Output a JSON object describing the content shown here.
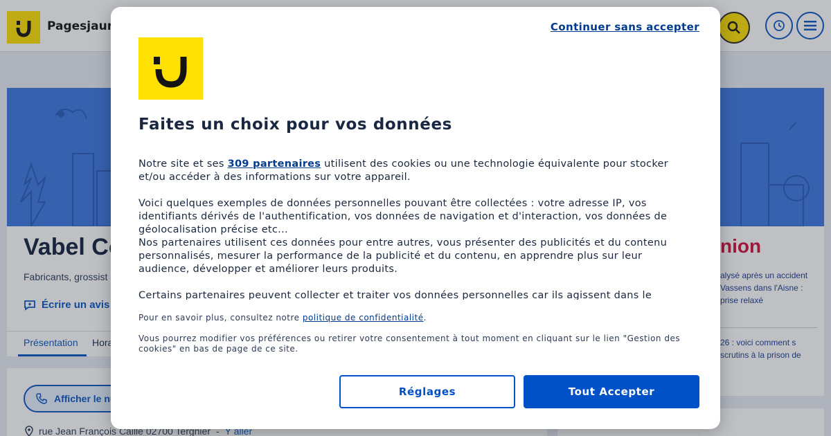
{
  "background": {
    "brand": "Pagesjaune",
    "business_name": "Vabel Co",
    "business_category": "Fabricants, grossist",
    "write_review": "Écrire un avis",
    "tabs": [
      {
        "label": "Présentation"
      },
      {
        "label": "Hora"
      }
    ],
    "phone_button": "Afficher le nu",
    "address": "rue Jean François Caille 02700 Tergnier",
    "address_sep": "-",
    "go_link": "Y aller",
    "news_brand": "nion",
    "news": [
      {
        "text": "alysé après un accident Vassens dans l'Aisne : prise relaxé"
      },
      {
        "text": "26 : voici comment s scrutins à la prison de"
      }
    ]
  },
  "consent": {
    "continue_without": "Continuer sans accepter",
    "title": "Faites un choix pour vos données",
    "p1_before": "Notre site et ses ",
    "p1_link": "309 partenaires",
    "p1_after": " utilisent des cookies ou une technologie équivalente pour stocker et/ou accéder à des informations sur votre appareil.",
    "p2": "Voici quelques exemples de données personnelles pouvant être collectées : votre adresse IP, vos identifiants dérivés de l'authentification, vos données de navigation et d'interaction, vos données de géolocalisation précise etc...",
    "p3": "Nos partenaires utilisent ces données pour entre autres, vous présenter des publicités et du contenu personnalisés, mesurer la performance de la publicité et du contenu, en apprendre plus sur leur audience, développer et améliorer leurs produits.",
    "p4": "Certains partenaires peuvent collecter et traiter vos données personnelles car ils agissent dans le",
    "more_info_before": "Pour en savoir plus, consultez notre ",
    "more_info_link": "politique de confidentialité",
    "more_info_after": ".",
    "prefs_note": "Vous pourrez modifier vos préférences ou retirer votre consentement à tout moment en cliquant sur le lien \"Gestion des cookies\" en bas de page de ce site.",
    "settings_button": "Réglages",
    "accept_button": "Tout Accepter"
  },
  "colors": {
    "brand_yellow": "#ffe000",
    "primary_blue": "#0050c8",
    "link_blue": "#003b8e",
    "news_red": "#d0103a"
  },
  "icons": [
    "smiley-logo-icon",
    "search-icon",
    "history-icon",
    "menu-icon",
    "comment-icon",
    "phone-icon",
    "location-pin-icon"
  ]
}
